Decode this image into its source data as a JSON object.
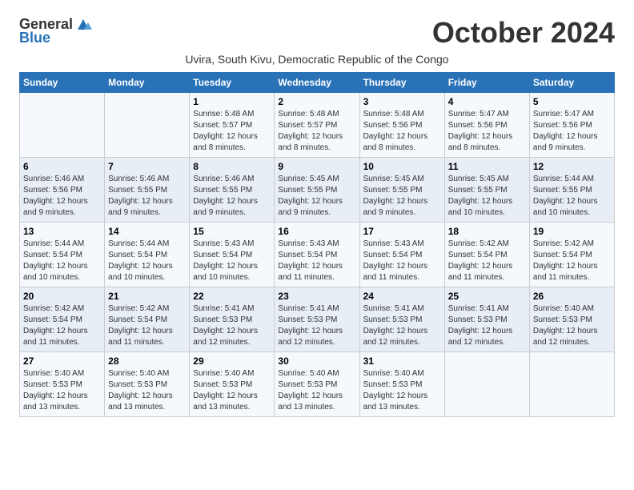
{
  "logo": {
    "text_general": "General",
    "text_blue": "Blue"
  },
  "title": "October 2024",
  "subtitle": "Uvira, South Kivu, Democratic Republic of the Congo",
  "headers": [
    "Sunday",
    "Monday",
    "Tuesday",
    "Wednesday",
    "Thursday",
    "Friday",
    "Saturday"
  ],
  "weeks": [
    [
      {
        "day": "",
        "info": ""
      },
      {
        "day": "",
        "info": ""
      },
      {
        "day": "1",
        "info": "Sunrise: 5:48 AM\nSunset: 5:57 PM\nDaylight: 12 hours\nand 8 minutes."
      },
      {
        "day": "2",
        "info": "Sunrise: 5:48 AM\nSunset: 5:57 PM\nDaylight: 12 hours\nand 8 minutes."
      },
      {
        "day": "3",
        "info": "Sunrise: 5:48 AM\nSunset: 5:56 PM\nDaylight: 12 hours\nand 8 minutes."
      },
      {
        "day": "4",
        "info": "Sunrise: 5:47 AM\nSunset: 5:56 PM\nDaylight: 12 hours\nand 8 minutes."
      },
      {
        "day": "5",
        "info": "Sunrise: 5:47 AM\nSunset: 5:56 PM\nDaylight: 12 hours\nand 9 minutes."
      }
    ],
    [
      {
        "day": "6",
        "info": "Sunrise: 5:46 AM\nSunset: 5:56 PM\nDaylight: 12 hours\nand 9 minutes."
      },
      {
        "day": "7",
        "info": "Sunrise: 5:46 AM\nSunset: 5:55 PM\nDaylight: 12 hours\nand 9 minutes."
      },
      {
        "day": "8",
        "info": "Sunrise: 5:46 AM\nSunset: 5:55 PM\nDaylight: 12 hours\nand 9 minutes."
      },
      {
        "day": "9",
        "info": "Sunrise: 5:45 AM\nSunset: 5:55 PM\nDaylight: 12 hours\nand 9 minutes."
      },
      {
        "day": "10",
        "info": "Sunrise: 5:45 AM\nSunset: 5:55 PM\nDaylight: 12 hours\nand 9 minutes."
      },
      {
        "day": "11",
        "info": "Sunrise: 5:45 AM\nSunset: 5:55 PM\nDaylight: 12 hours\nand 10 minutes."
      },
      {
        "day": "12",
        "info": "Sunrise: 5:44 AM\nSunset: 5:55 PM\nDaylight: 12 hours\nand 10 minutes."
      }
    ],
    [
      {
        "day": "13",
        "info": "Sunrise: 5:44 AM\nSunset: 5:54 PM\nDaylight: 12 hours\nand 10 minutes."
      },
      {
        "day": "14",
        "info": "Sunrise: 5:44 AM\nSunset: 5:54 PM\nDaylight: 12 hours\nand 10 minutes."
      },
      {
        "day": "15",
        "info": "Sunrise: 5:43 AM\nSunset: 5:54 PM\nDaylight: 12 hours\nand 10 minutes."
      },
      {
        "day": "16",
        "info": "Sunrise: 5:43 AM\nSunset: 5:54 PM\nDaylight: 12 hours\nand 11 minutes."
      },
      {
        "day": "17",
        "info": "Sunrise: 5:43 AM\nSunset: 5:54 PM\nDaylight: 12 hours\nand 11 minutes."
      },
      {
        "day": "18",
        "info": "Sunrise: 5:42 AM\nSunset: 5:54 PM\nDaylight: 12 hours\nand 11 minutes."
      },
      {
        "day": "19",
        "info": "Sunrise: 5:42 AM\nSunset: 5:54 PM\nDaylight: 12 hours\nand 11 minutes."
      }
    ],
    [
      {
        "day": "20",
        "info": "Sunrise: 5:42 AM\nSunset: 5:54 PM\nDaylight: 12 hours\nand 11 minutes."
      },
      {
        "day": "21",
        "info": "Sunrise: 5:42 AM\nSunset: 5:54 PM\nDaylight: 12 hours\nand 11 minutes."
      },
      {
        "day": "22",
        "info": "Sunrise: 5:41 AM\nSunset: 5:53 PM\nDaylight: 12 hours\nand 12 minutes."
      },
      {
        "day": "23",
        "info": "Sunrise: 5:41 AM\nSunset: 5:53 PM\nDaylight: 12 hours\nand 12 minutes."
      },
      {
        "day": "24",
        "info": "Sunrise: 5:41 AM\nSunset: 5:53 PM\nDaylight: 12 hours\nand 12 minutes."
      },
      {
        "day": "25",
        "info": "Sunrise: 5:41 AM\nSunset: 5:53 PM\nDaylight: 12 hours\nand 12 minutes."
      },
      {
        "day": "26",
        "info": "Sunrise: 5:40 AM\nSunset: 5:53 PM\nDaylight: 12 hours\nand 12 minutes."
      }
    ],
    [
      {
        "day": "27",
        "info": "Sunrise: 5:40 AM\nSunset: 5:53 PM\nDaylight: 12 hours\nand 13 minutes."
      },
      {
        "day": "28",
        "info": "Sunrise: 5:40 AM\nSunset: 5:53 PM\nDaylight: 12 hours\nand 13 minutes."
      },
      {
        "day": "29",
        "info": "Sunrise: 5:40 AM\nSunset: 5:53 PM\nDaylight: 12 hours\nand 13 minutes."
      },
      {
        "day": "30",
        "info": "Sunrise: 5:40 AM\nSunset: 5:53 PM\nDaylight: 12 hours\nand 13 minutes."
      },
      {
        "day": "31",
        "info": "Sunrise: 5:40 AM\nSunset: 5:53 PM\nDaylight: 12 hours\nand 13 minutes."
      },
      {
        "day": "",
        "info": ""
      },
      {
        "day": "",
        "info": ""
      }
    ]
  ]
}
